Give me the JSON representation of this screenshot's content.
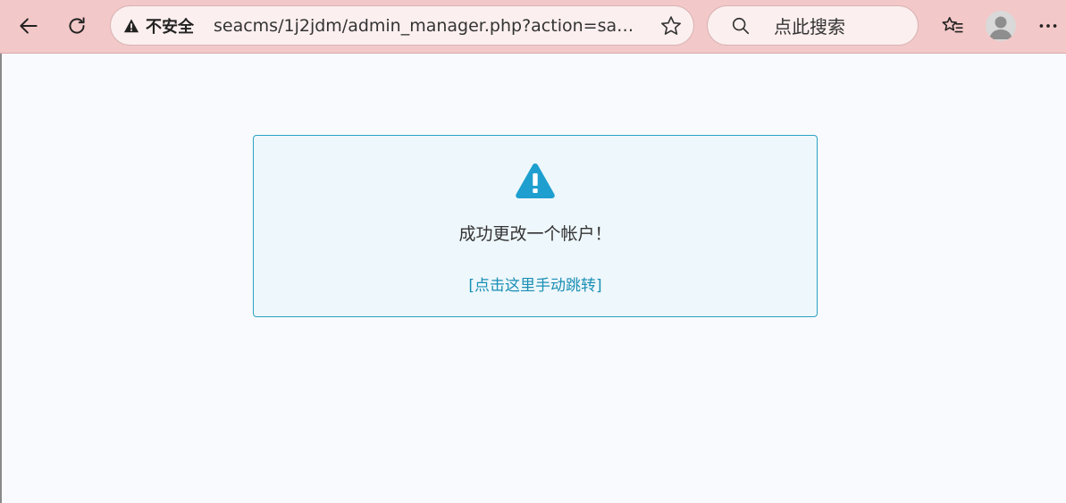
{
  "browser": {
    "security_label": "不安全",
    "url": "seacms/1j2jdm/admin_manager.php?action=save...",
    "search_placeholder": "点此搜索",
    "icons": {
      "back": "back-arrow-icon",
      "reload": "reload-icon",
      "warning": "warning-icon",
      "favorite": "star-icon",
      "search": "search-icon",
      "favorites_list": "favorites-icon",
      "profile": "avatar",
      "menu": "more-icon"
    }
  },
  "page": {
    "message": "成功更改一个帐户！",
    "redirect_link": "[点击这里手动跳转]",
    "colors": {
      "accent": "#1a8fb5",
      "alert_icon": "#1e9fcf",
      "box_border": "#2aa3c4",
      "box_background": "#eef7fb",
      "toolbar": "#f3c8c8"
    }
  }
}
